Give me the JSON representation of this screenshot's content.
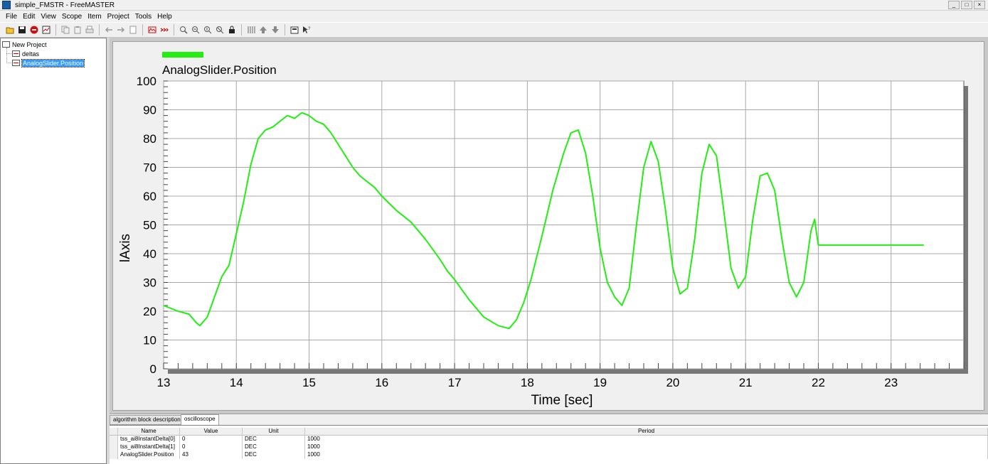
{
  "window": {
    "title": "simple_FMSTR - FreeMASTER",
    "controls": [
      "_",
      "□",
      "×"
    ]
  },
  "menu": [
    "File",
    "Edit",
    "View",
    "Scope",
    "Item",
    "Project",
    "Tools",
    "Help"
  ],
  "toolbar_icons": [
    "open-icon",
    "save-icon",
    "stop-icon",
    "options-icon",
    "copy-icon",
    "paste-icon",
    "print-icon",
    "back-icon",
    "forward-icon",
    "page-icon",
    "record-icon",
    "run-icon",
    "zoom-icon",
    "zoom-x-icon",
    "zoom-y-icon",
    "zoom-fit-icon",
    "lock-icon",
    "grid-icon",
    "up-icon",
    "down-icon",
    "properties-icon",
    "help-cursor-icon"
  ],
  "tree": {
    "root": "New Project",
    "items": [
      "deltas",
      "AnalogSlider.Position"
    ],
    "selected": 1
  },
  "tabs": [
    {
      "label": "algorithm block description",
      "active": false
    },
    {
      "label": "oscilloscope",
      "active": true
    }
  ],
  "grid": {
    "columns": [
      "Name",
      "Value",
      "Unit",
      "Period"
    ],
    "rows": [
      [
        "tss_ai8InstantDelta[0]",
        "0",
        "DEC",
        "1000"
      ],
      [
        "tss_ai8InstantDelta[1]",
        "0",
        "DEC",
        "1000"
      ],
      [
        "AnalogSlider.Position",
        "43",
        "DEC",
        "1000"
      ]
    ]
  },
  "chart_data": {
    "type": "line",
    "title": "",
    "xlabel": "Time [sec]",
    "ylabel": "lAxis",
    "xlim": [
      13,
      24
    ],
    "ylim": [
      0,
      100
    ],
    "xticks": [
      13,
      14,
      15,
      16,
      17,
      18,
      19,
      20,
      21,
      22,
      23
    ],
    "yticks": [
      0,
      10,
      20,
      30,
      40,
      50,
      60,
      70,
      80,
      90,
      100
    ],
    "grid": true,
    "legend_placement": "top-left",
    "colors": {
      "series": "#22ee11",
      "grid": "#a8a8a8",
      "plot_bg": "#ffffff"
    },
    "series": [
      {
        "name": "AnalogSlider.Position",
        "x": [
          13.0,
          13.2,
          13.35,
          13.45,
          13.5,
          13.6,
          13.7,
          13.8,
          13.9,
          14.0,
          14.1,
          14.2,
          14.3,
          14.4,
          14.5,
          14.6,
          14.7,
          14.8,
          14.9,
          15.0,
          15.1,
          15.2,
          15.3,
          15.4,
          15.5,
          15.6,
          15.7,
          15.8,
          15.9,
          16.0,
          16.2,
          16.4,
          16.6,
          16.8,
          16.9,
          17.0,
          17.2,
          17.4,
          17.6,
          17.75,
          17.85,
          17.95,
          18.05,
          18.2,
          18.35,
          18.5,
          18.6,
          18.7,
          18.8,
          18.9,
          19.0,
          19.1,
          19.2,
          19.3,
          19.4,
          19.5,
          19.6,
          19.7,
          19.8,
          19.9,
          20.0,
          20.1,
          20.2,
          20.3,
          20.4,
          20.5,
          20.6,
          20.7,
          20.8,
          20.9,
          21.0,
          21.1,
          21.2,
          21.3,
          21.4,
          21.5,
          21.6,
          21.7,
          21.8,
          21.9,
          21.95,
          21.97,
          22.0,
          23.45
        ],
        "y": [
          22,
          20,
          19,
          16,
          15,
          18,
          25,
          32,
          36,
          47,
          58,
          71,
          80,
          83,
          84,
          86,
          88,
          87,
          89,
          88,
          86,
          85,
          82,
          78,
          74,
          70,
          67,
          65,
          63,
          60,
          55,
          51,
          45,
          38,
          34,
          31,
          24,
          18,
          15,
          14,
          17,
          23,
          31,
          46,
          62,
          75,
          82,
          83,
          75,
          60,
          42,
          30,
          25,
          22,
          28,
          50,
          70,
          79,
          72,
          55,
          35,
          26,
          28,
          45,
          68,
          78,
          74,
          55,
          35,
          28,
          32,
          52,
          67,
          68,
          62,
          45,
          30,
          25,
          30,
          48,
          52,
          48,
          43,
          43
        ]
      }
    ]
  }
}
